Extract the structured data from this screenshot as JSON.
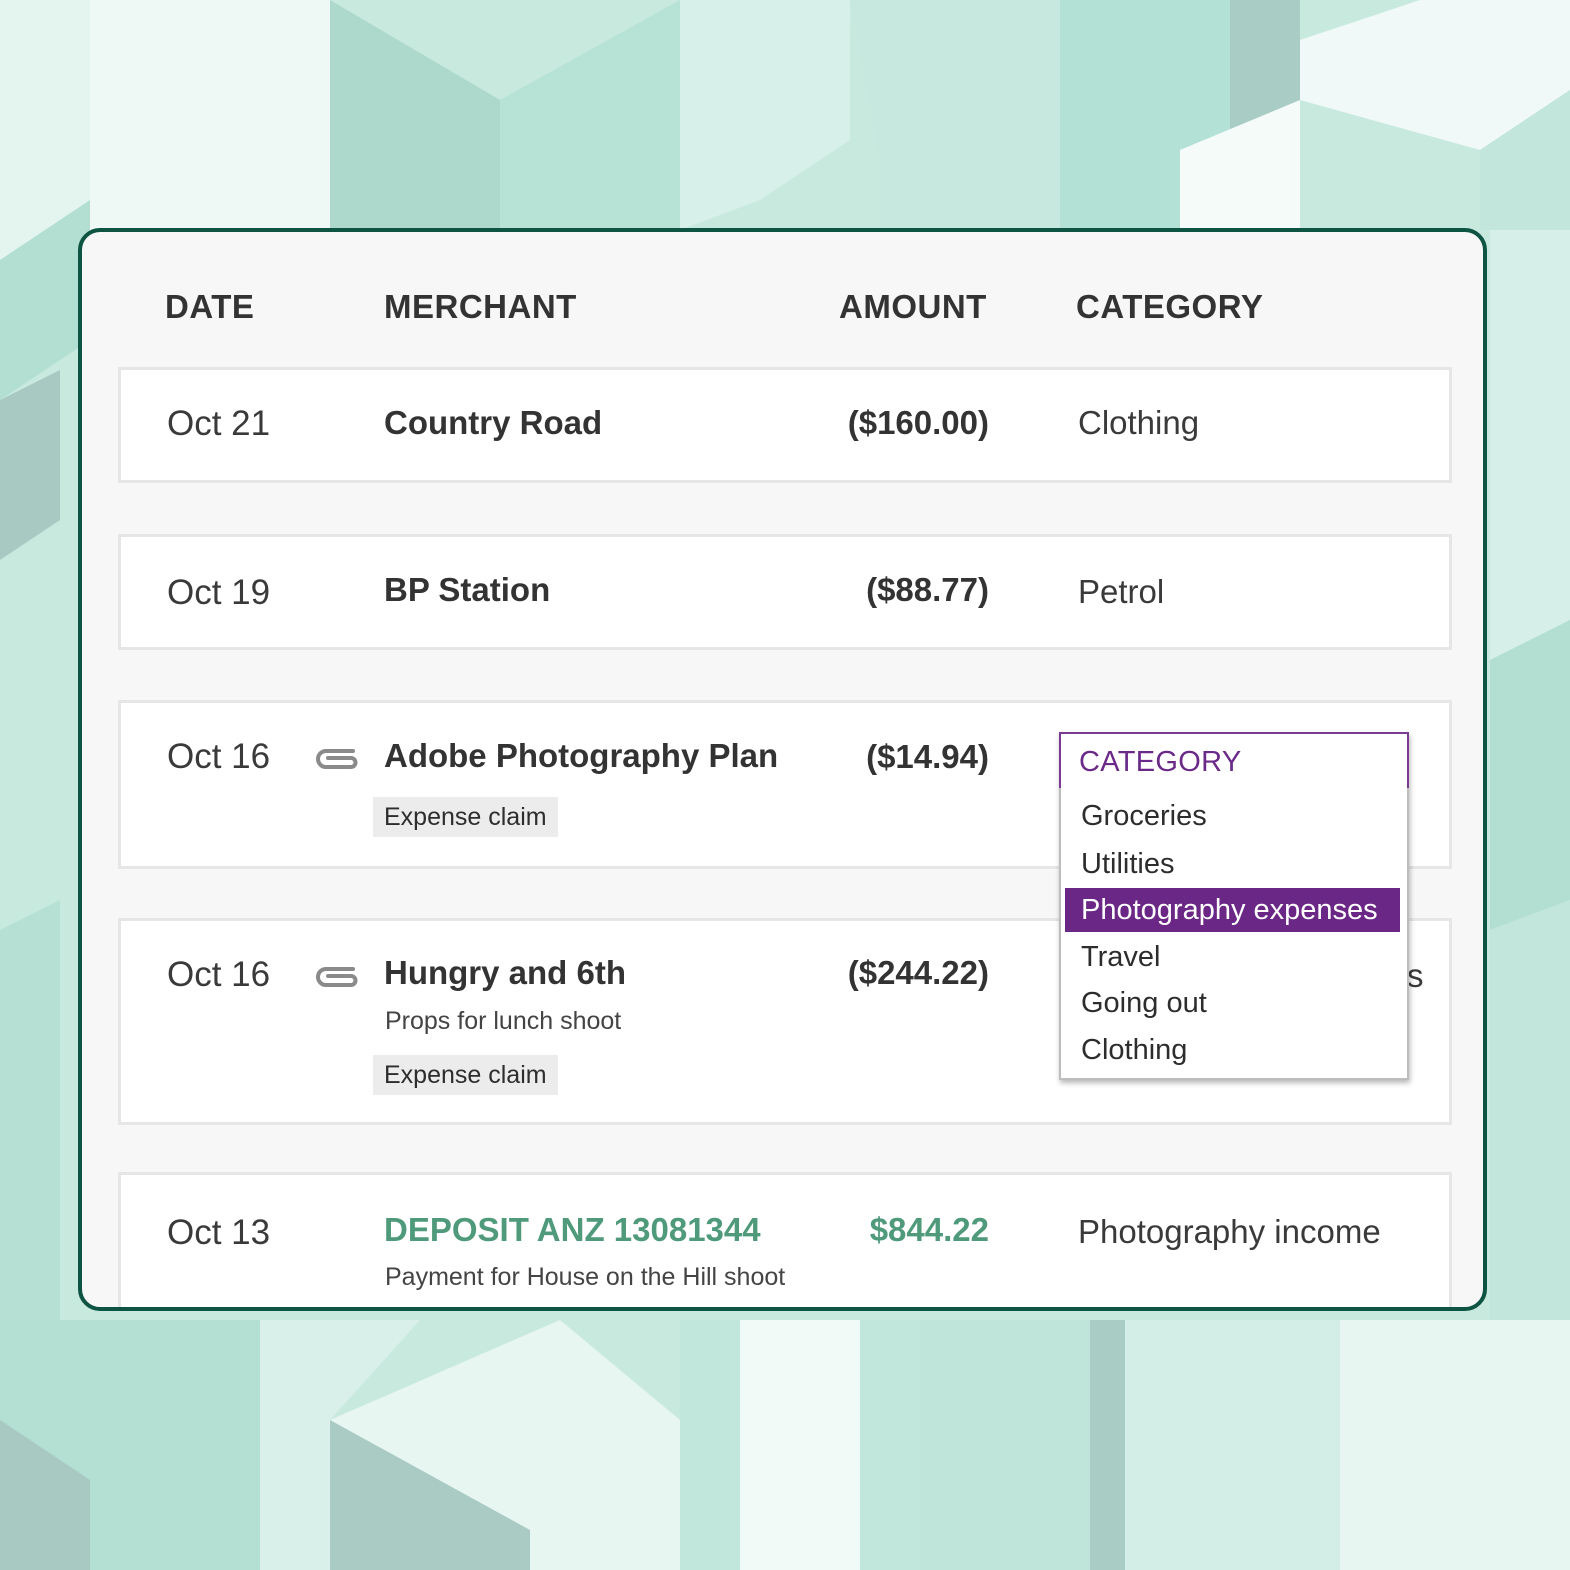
{
  "table": {
    "headers": {
      "date": "DATE",
      "merchant": "MERCHANT",
      "amount": "AMOUNT",
      "category": "CATEGORY"
    },
    "rows": [
      {
        "date": "Oct 21",
        "merchant": "Country Road",
        "amount": "($160.00)",
        "category": "Clothing"
      },
      {
        "date": "Oct 19",
        "merchant": "BP Station",
        "amount": "($88.77)",
        "category": "Petrol"
      },
      {
        "date": "Oct 16",
        "merchant": "Adobe Photography Plan",
        "amount": "($14.94)",
        "tag": "Expense claim",
        "has_attachment": true
      },
      {
        "date": "Oct 16",
        "merchant": "Hungry and 6th",
        "amount": "($244.22)",
        "note": "Props for lunch shoot",
        "tag": "Expense claim",
        "has_attachment": true,
        "category_partial": "s"
      },
      {
        "date": "Oct 13",
        "merchant": "DEPOSIT ANZ 13081344",
        "amount": "$844.22",
        "category": "Photography income",
        "note": "Payment for House on the Hill shoot"
      }
    ]
  },
  "category_dropdown": {
    "title": "CATEGORY",
    "options": [
      "Groceries",
      "Utilities",
      "Photography expenses",
      "Travel",
      "Going out",
      "Clothing"
    ],
    "selected": "Photography expenses"
  },
  "colors": {
    "card_border": "#0e5442",
    "deposit_green": "#4f9a7a",
    "dropdown_accent": "#6a2785",
    "background": "#c8e9de"
  },
  "icons": {
    "attachment": "paperclip-icon"
  }
}
